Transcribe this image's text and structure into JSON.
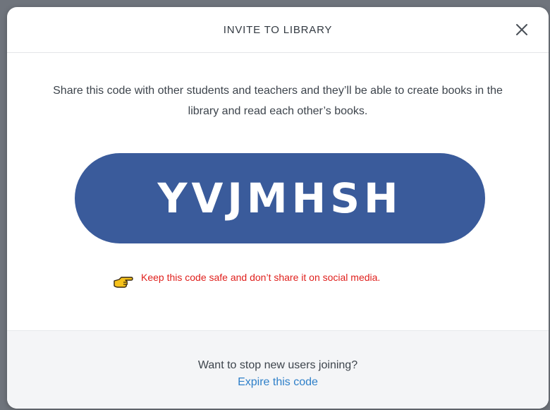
{
  "modal": {
    "title": "INVITE TO LIBRARY",
    "close_icon": "close-icon",
    "description": "Share this code with other students and teachers and they’ll be able to create books in the library and read each other’s books.",
    "invite_code": "YVJMHSH",
    "warning": {
      "icon": "pointing-hand-icon",
      "text": "Keep this code safe and don’t share it on social media."
    },
    "footer": {
      "question": "Want to stop new users joining?",
      "link_label": "Expire this code"
    }
  },
  "colors": {
    "code_background": "#3a5b9b",
    "warning_text": "#e0201d",
    "link": "#2f80c9"
  }
}
